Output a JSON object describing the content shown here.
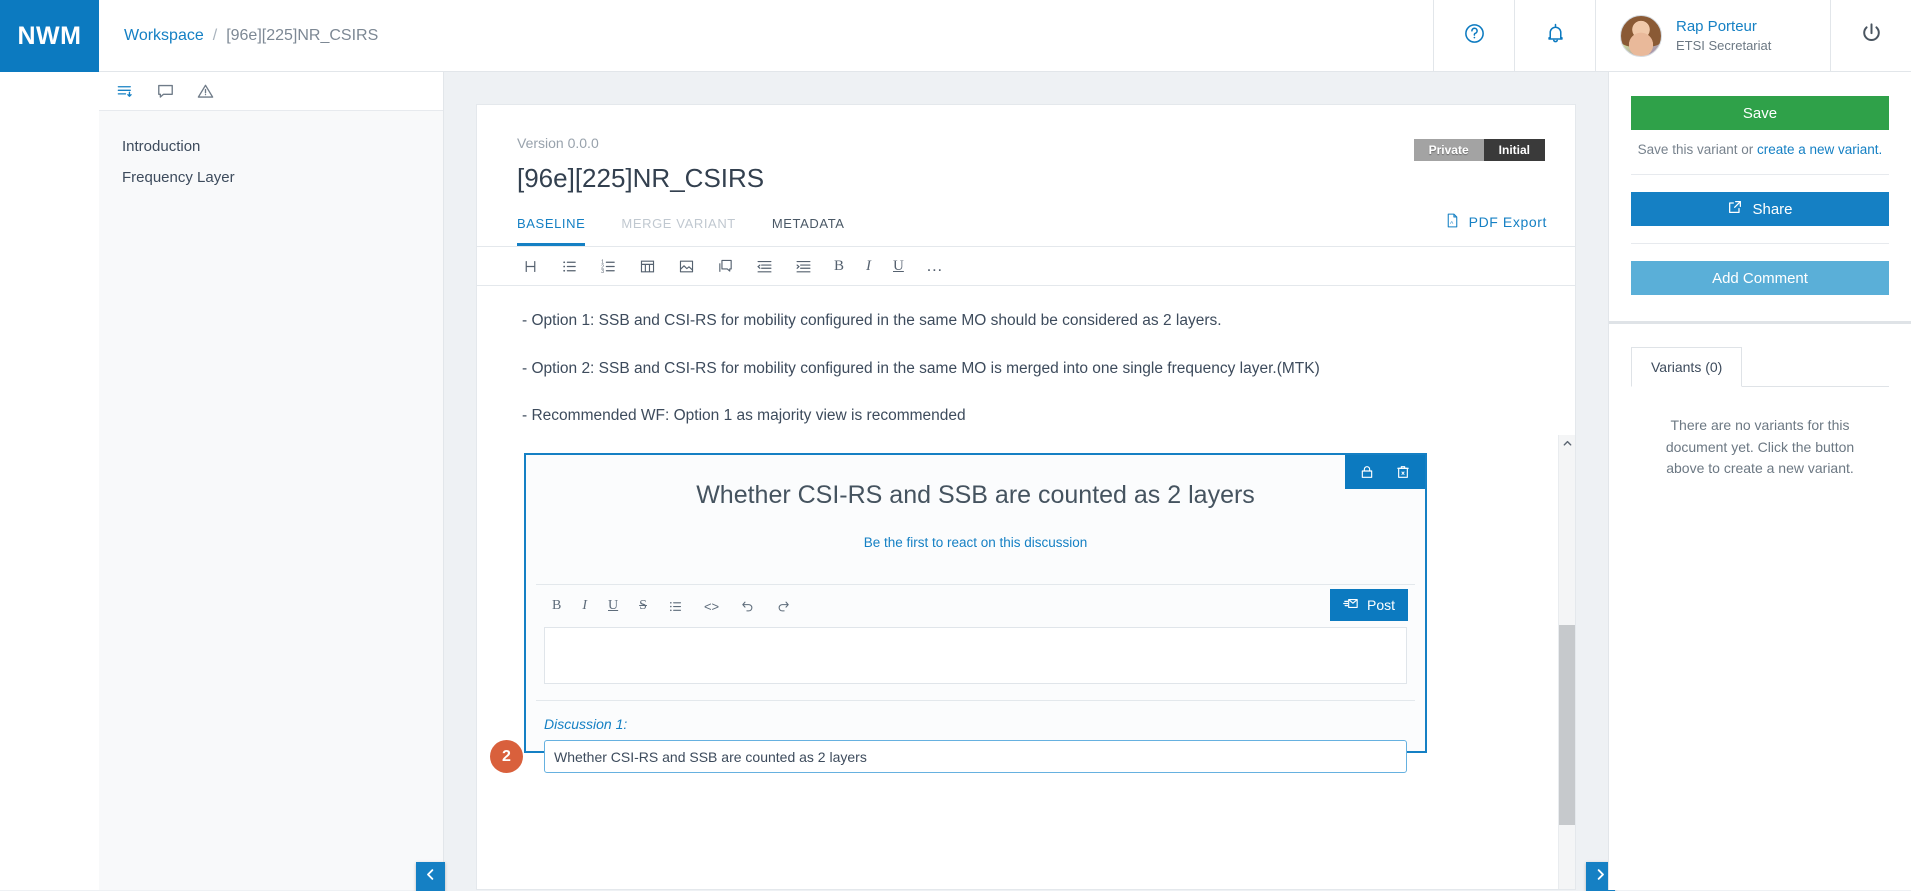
{
  "app": {
    "logo": "NWM"
  },
  "topbar": {
    "breadcrumb": {
      "workspace": "Workspace",
      "separator": "/",
      "current": "[96e][225]NR_CSIRS"
    },
    "help_icon": "help-circle-icon",
    "bell_icon": "bell-icon",
    "power_icon": "power-icon",
    "user": {
      "name": "Rap Porteur",
      "role": "ETSI Secretariat"
    }
  },
  "outline": {
    "tools": [
      {
        "name": "table-of-contents-icon",
        "active": true
      },
      {
        "name": "comments-icon",
        "active": false
      },
      {
        "name": "issues-icon",
        "active": false
      }
    ],
    "items": [
      {
        "label": "Introduction"
      },
      {
        "label": "Frequency Layer"
      }
    ]
  },
  "document": {
    "version": "Version 0.0.0",
    "title": "[96e][225]NR_CSIRS",
    "badges": {
      "visibility": "Private",
      "state": "Initial"
    },
    "tabs": [
      {
        "label": "BASELINE",
        "state": "active"
      },
      {
        "label": "MERGE VARIANT",
        "state": "disabled"
      },
      {
        "label": "METADATA",
        "state": "normal"
      }
    ],
    "pdf_export": "PDF Export",
    "toolbar": [
      {
        "name": "heading-icon",
        "label": "H"
      },
      {
        "name": "bulleted-list-icon"
      },
      {
        "name": "numbered-list-icon"
      },
      {
        "name": "table-icon"
      },
      {
        "name": "image-icon"
      },
      {
        "name": "discussion-icon"
      },
      {
        "name": "outdent-icon"
      },
      {
        "name": "indent-icon"
      },
      {
        "name": "bold-icon",
        "label": "B"
      },
      {
        "name": "italic-icon",
        "label": "I"
      },
      {
        "name": "underline-icon",
        "label": "U"
      },
      {
        "name": "more-options-icon",
        "label": "…"
      }
    ],
    "paragraphs": [
      "- Option 1: SSB and CSI-RS for mobility configured in the same MO should be considered as 2 layers.",
      "- Option 2: SSB and CSI-RS for mobility configured in the same MO is merged into one single frequency layer.(MTK)",
      "- Recommended WF: Option 1 as majority view is recommended"
    ]
  },
  "discussion": {
    "title": "Whether CSI-RS and SSB are counted as 2 layers",
    "react_link": "Be the first to react on this discussion",
    "actions": [
      {
        "name": "lock-icon"
      },
      {
        "name": "delete-icon"
      }
    ],
    "reply_toolbar": [
      {
        "name": "bold-icon",
        "label": "B"
      },
      {
        "name": "italic-icon",
        "label": "I"
      },
      {
        "name": "underline-icon",
        "label": "U"
      },
      {
        "name": "strikethrough-icon",
        "label": "S"
      },
      {
        "name": "bulleted-list-icon"
      },
      {
        "name": "code-icon",
        "label": "<>"
      },
      {
        "name": "undo-icon"
      },
      {
        "name": "redo-icon"
      }
    ],
    "post_label": "Post",
    "reply_placeholder": "",
    "field_label": "Discussion 1:",
    "field_value": "Whether CSI-RS and SSB are counted as 2 layers",
    "step_marker": "2"
  },
  "right_panel": {
    "save_label": "Save",
    "save_note_prefix": "Save this variant or ",
    "save_note_link": "create a new variant.",
    "share_label": "Share",
    "add_comment_label": "Add Comment",
    "variants_tab": "Variants (0)",
    "variants_empty": "There are no variants for this document yet. Click the button above to create a new variant."
  },
  "navigation": {
    "prev_icon": "chevron-left-icon",
    "next_icon": "chevron-right-icon"
  },
  "colors": {
    "brand_blue": "#0c7ac0",
    "link_blue": "#1580c4",
    "save_green": "#2fa149",
    "comment_blue": "#5aafd8",
    "marker_orange": "#d9603c",
    "badge_private": "#a3a3a3",
    "badge_initial": "#3a3a3a"
  }
}
